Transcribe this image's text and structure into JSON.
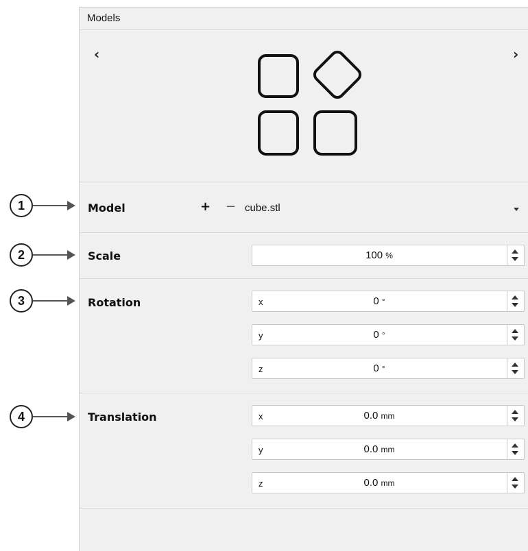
{
  "callouts": [
    "1",
    "2",
    "3",
    "4"
  ],
  "panel": {
    "title": "Models"
  },
  "nav": {
    "prev": "‹",
    "next": "›"
  },
  "logo_icon": "models-grid-icon",
  "model": {
    "label": "Model",
    "add": "+",
    "remove": "−",
    "selected": "cube.stl"
  },
  "scale": {
    "label": "Scale",
    "value": "100",
    "unit": "%"
  },
  "rotation": {
    "label": "Rotation",
    "fields": [
      {
        "axis": "x",
        "value": "0",
        "unit": "°"
      },
      {
        "axis": "y",
        "value": "0",
        "unit": "°"
      },
      {
        "axis": "z",
        "value": "0",
        "unit": "°"
      }
    ]
  },
  "translation": {
    "label": "Translation",
    "fields": [
      {
        "axis": "x",
        "value": "0.0",
        "unit": "mm"
      },
      {
        "axis": "y",
        "value": "0.0",
        "unit": "mm"
      },
      {
        "axis": "z",
        "value": "0.0",
        "unit": "mm"
      }
    ]
  }
}
